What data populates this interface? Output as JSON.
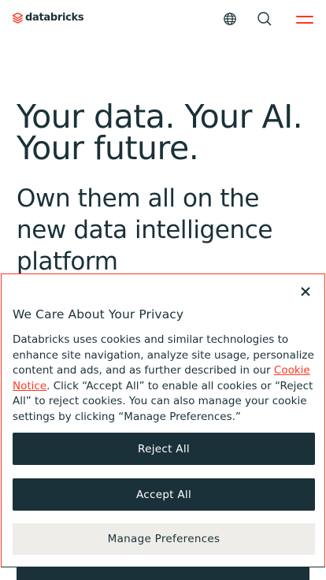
{
  "header": {
    "logo_text": "databricks",
    "icons": [
      "globe-icon",
      "search-icon",
      "hamburger-menu-icon"
    ],
    "accent_color": "#ff3621"
  },
  "hero": {
    "title": "Your data. Your AI. Your future.",
    "subtitle": "Own them all on the new data intelligence platform"
  },
  "cookie_banner": {
    "title": "We Care About Your Privacy",
    "body_part1": "Databricks uses cookies and similar technologies to enhance site navigation, analyze site usage, personalize content and ads, and as further described in our ",
    "link_text": "Cookie Notice",
    "body_part2": ". Click “Accept All” to enable all cookies or “Reject All” to reject cookies. You can also manage your cookie settings by clicking “Manage Preferences.”",
    "reject_label": "Reject All",
    "accept_label": "Accept All",
    "manage_label": "Manage Preferences",
    "close_icon": "close-icon"
  },
  "colors": {
    "text_dark": "#1b3139",
    "button_light": "#eeede9"
  }
}
